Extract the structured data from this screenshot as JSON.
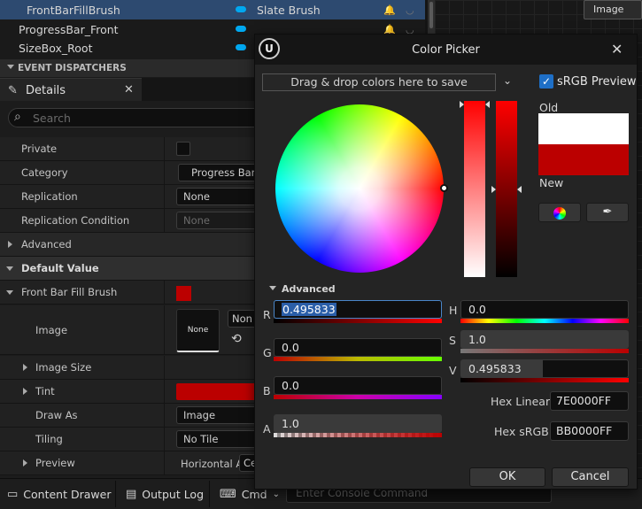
{
  "variables": [
    {
      "name": "FrontBarFillBrush",
      "type": "Slate Brush",
      "selected": true
    },
    {
      "name": "ProgressBar_Front",
      "type": ""
    },
    {
      "name": "SizeBox_Root",
      "type": ""
    }
  ],
  "event_dispatchers_header": "EVENT DISPATCHERS",
  "graph_node_label": "Image",
  "details": {
    "tab_label": "Details",
    "search_placeholder": "Search",
    "rows": {
      "private": "Private",
      "category": "Category",
      "category_value": "Progress Bar I",
      "replication": "Replication",
      "replication_value": "None",
      "replication_condition": "Replication Condition",
      "replication_condition_value": "None",
      "advanced": "Advanced",
      "default_value": "Default Value",
      "front_bar_fill_brush": "Front Bar Fill Brush",
      "image": "Image",
      "image_thumb": "None",
      "image_value": "Non",
      "image_size": "Image Size",
      "tint": "Tint",
      "draw_as": "Draw As",
      "draw_as_value": "Image",
      "tiling": "Tiling",
      "tiling_value": "No Tile",
      "preview": "Preview",
      "preview_value": "Horizontal A",
      "preview_value2": "Ce"
    },
    "swatch_color": "#bb0000"
  },
  "bottom_bar": {
    "content_drawer": "Content Drawer",
    "output_log": "Output Log",
    "cmd": "Cmd",
    "console_placeholder": "Enter Console Command"
  },
  "color_picker": {
    "title": "Color Picker",
    "drop_zone": "Drag & drop colors here to save",
    "srgb_preview": "sRGB Preview",
    "old_label": "Old",
    "new_label": "New",
    "old_color": "#ffffff",
    "new_color": "#bb0000",
    "advanced_label": "Advanced",
    "channels": {
      "r_label": "R",
      "r_value": "0.495833",
      "g_label": "G",
      "g_value": "0.0",
      "b_label": "B",
      "b_value": "0.0",
      "a_label": "A",
      "a_value": "1.0",
      "h_label": "H",
      "h_value": "0.0",
      "s_label": "S",
      "s_value": "1.0",
      "v_label": "V",
      "v_value": "0.495833"
    },
    "hex_linear_label": "Hex Linear",
    "hex_linear_value": "7E0000FF",
    "hex_srgb_label": "Hex sRGB",
    "hex_srgb_value": "BB0000FF",
    "ok_label": "OK",
    "cancel_label": "Cancel"
  }
}
